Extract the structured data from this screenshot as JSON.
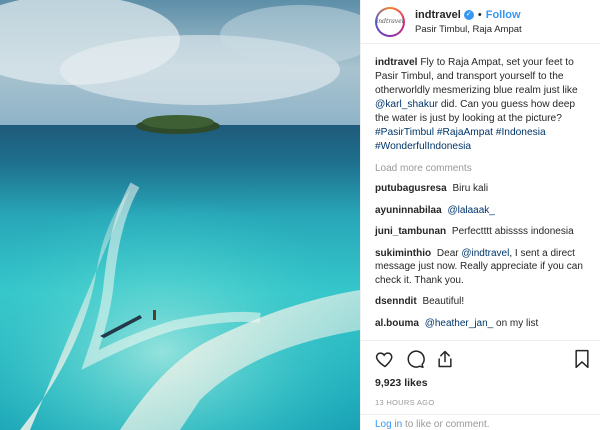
{
  "post": {
    "username": "indtravel",
    "avatar_text": "indtravel",
    "follow_label": "Follow",
    "separator": "•",
    "location": "Pasir Timbul, Raja Ampat",
    "caption": {
      "username": "indtravel",
      "text_1": "Fly to Raja Ampat, set your feet to Pasir Timbul, and transport yourself to the otherworldly mesmerizing blue realm just like",
      "mention": "@karl_shakur",
      "text_2": "did. Can you guess how deep the water is just by looking at the picture?",
      "hashtags_1": "#PasirTimbul #RajaAmpat #Indonesia",
      "hashtags_2": "#WonderfulIndonesia"
    },
    "load_more": "Load more comments",
    "comments": [
      {
        "user": "putubagusresa",
        "text": "Biru kali"
      },
      {
        "user": "ayuninnabilaa",
        "mention": "@lalaaak_"
      },
      {
        "user": "juni_tambunan",
        "text": "Perfectttt abissss indonesia"
      },
      {
        "user": "sukiminthio",
        "text_1": "Dear",
        "mention": "@indtravel",
        "text_2": ", I sent a direct message just now. Really appreciate if you can check it. Thank you."
      },
      {
        "user": "dsenndit",
        "text": "Beautiful!"
      },
      {
        "user": "al.bouma",
        "mention": "@heather_jan_",
        "text": "on my list"
      }
    ],
    "likes": "9,923 likes",
    "time": "13 HOURS AGO",
    "login": {
      "link": "Log in",
      "text": "to like or comment."
    }
  },
  "icons": [
    "heart-icon",
    "comment-icon",
    "share-icon",
    "bookmark-icon",
    "verified-badge-icon"
  ],
  "colors": {
    "link_blue": "#3897f0",
    "mention_blue": "#003569",
    "muted": "#999999",
    "sea_turquoise": "#2fc4c9",
    "sky": "#8fb4c8"
  }
}
